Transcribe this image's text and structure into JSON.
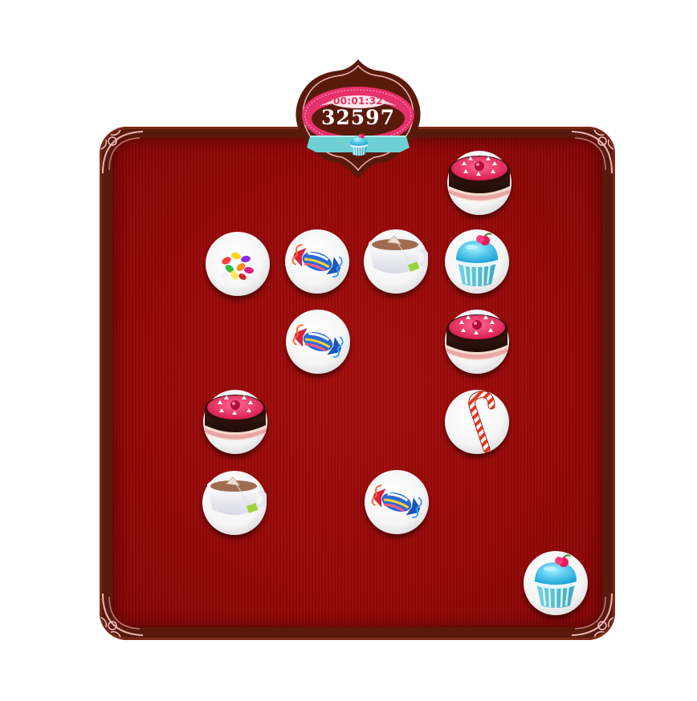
{
  "hud": {
    "timer": "00:01:32",
    "score": "32597"
  },
  "colors": {
    "felt": "#9b0a0a",
    "frame": "#5a1a0b",
    "plaque_pink": "#e8306a",
    "ribbon": "#6fd0d3"
  },
  "board": {
    "tiles": [
      {
        "item": "cake-icon"
      },
      {
        "item": "jelly-beans-icon"
      },
      {
        "item": "wrapped-candy-icon"
      },
      {
        "item": "tea-cup-icon"
      },
      {
        "item": "cupcake-icon"
      },
      {
        "item": "wrapped-candy-icon"
      },
      {
        "item": "cake-icon"
      },
      {
        "item": "cake-icon"
      },
      {
        "item": "candy-cane-icon"
      },
      {
        "item": "tea-cup-icon"
      },
      {
        "item": "wrapped-candy-icon"
      },
      {
        "item": "cupcake-icon"
      }
    ]
  }
}
